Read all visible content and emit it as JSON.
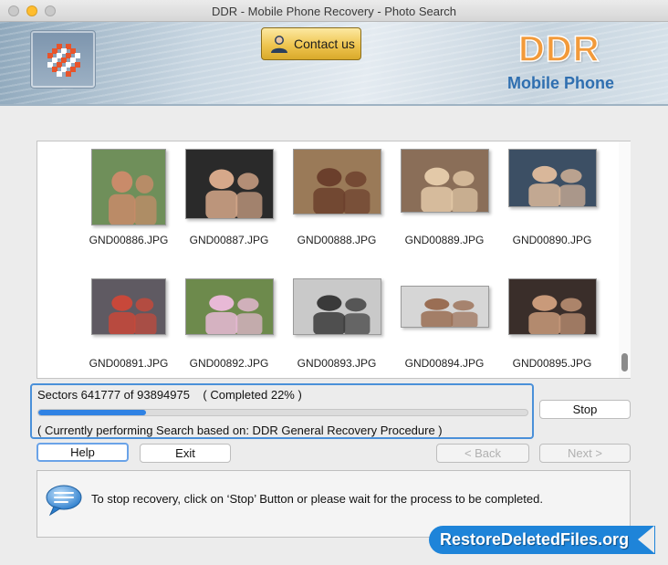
{
  "window": {
    "title": "DDR - Mobile Phone Recovery - Photo Search"
  },
  "header": {
    "contact_label": "Contact us",
    "brand": "DDR",
    "brand_sub": "Mobile Phone",
    "brand_color": "#f29a3a",
    "sub_color": "#2f6fb0"
  },
  "gallery": {
    "items": [
      {
        "name": "GND00886.JPG",
        "bg": "#6f8f5a",
        "fg": "#c98b6a"
      },
      {
        "name": "GND00887.JPG",
        "bg": "#2a2a2a",
        "fg": "#d6a88a"
      },
      {
        "name": "GND00888.JPG",
        "bg": "#9a7a58",
        "fg": "#6b3f2c"
      },
      {
        "name": "GND00889.JPG",
        "bg": "#8a6e58",
        "fg": "#e3c9a8"
      },
      {
        "name": "GND00890.JPG",
        "bg": "#3c4f64",
        "fg": "#d9b79a"
      },
      {
        "name": "GND00891.JPG",
        "bg": "#5f5a62",
        "fg": "#c8483a"
      },
      {
        "name": "GND00892.JPG",
        "bg": "#6d8a4c",
        "fg": "#e8b9d6"
      },
      {
        "name": "GND00893.JPG",
        "bg": "#c9c9c9",
        "fg": "#3a3a3a"
      },
      {
        "name": "GND00894.JPG",
        "bg": "#d6d6d6",
        "fg": "#9a6e54"
      },
      {
        "name": "GND00895.JPG",
        "bg": "#3a2e2a",
        "fg": "#c99a7a"
      }
    ]
  },
  "progress": {
    "sectors_text": "Sectors 641777 of 93894975    ( Completed 22% )",
    "fraction": 0.22,
    "procedure_text": "( Currently performing Search based on: DDR General Recovery Procedure )"
  },
  "buttons": {
    "stop": "Stop",
    "help": "Help",
    "exit": "Exit",
    "back": "< Back",
    "next": "Next >"
  },
  "info": {
    "message": "To stop recovery, click on ‘Stop’ Button or please wait for the process to be completed."
  },
  "watermark": {
    "text": "RestoreDeletedFiles.org"
  }
}
